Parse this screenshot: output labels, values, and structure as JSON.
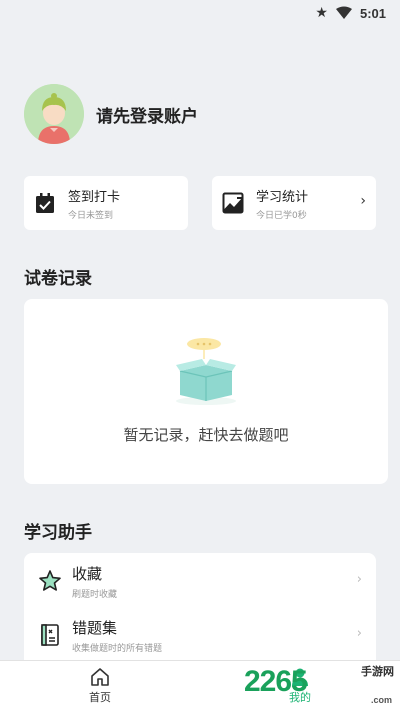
{
  "status_bar": {
    "time": "5:01"
  },
  "profile": {
    "name": "请先登录账户"
  },
  "quick_cards": [
    {
      "title": "签到打卡",
      "subtitle": "今日未签到",
      "icon": "calendar-check-icon"
    },
    {
      "title": "学习统计",
      "subtitle": "今日已学0秒",
      "icon": "trend-chart-icon"
    }
  ],
  "records": {
    "title": "试卷记录",
    "empty_text": "暂无记录，赶快去做题吧"
  },
  "assistant": {
    "title": "学习助手",
    "items": [
      {
        "title": "收藏",
        "subtitle": "刷题时收藏",
        "icon": "star-icon"
      },
      {
        "title": "错题集",
        "subtitle": "收集做题时的所有错题",
        "icon": "wrong-book-icon"
      }
    ]
  },
  "nav": [
    {
      "label": "首页",
      "icon": "home-icon",
      "active": false
    },
    {
      "label": "我的",
      "icon": "person-icon",
      "active": true
    }
  ],
  "watermark": {
    "brand": "2265",
    "text": "手游网",
    "domain": ".com"
  },
  "colors": {
    "accent": "#1bb373",
    "background": "#eef0f3"
  }
}
